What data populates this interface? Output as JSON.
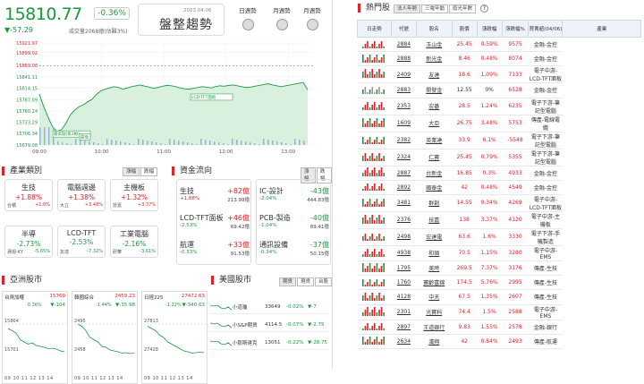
{
  "header": {
    "price": "15810.77",
    "change_pct": "-0.36%",
    "change": "▼-57.29",
    "volume": "成交量2068億(估難3%)",
    "trend_date": "2023.04.06",
    "trend_label": "盤整趨勢",
    "buttons": [
      "日週勢",
      "月週勢",
      "月週勢"
    ]
  },
  "chart_data": {
    "type": "line",
    "x_ticks": [
      "09:00",
      "10:00",
      "11:00",
      "12:00",
      "13:00"
    ],
    "y_ticks": [
      "15921.97",
      "15899.02",
      "15869.08",
      "15841.11",
      "15814.15",
      "15787.09",
      "15760.24",
      "15733.29",
      "15706.34",
      "15679.08"
    ],
    "ylim": [
      15679.08,
      15921.97
    ],
    "reference": 15868.06,
    "annotations": [
      "最高點(第1根)",
      "最低",
      "LCD-TFT面板"
    ],
    "values": [
      15800,
      15770,
      15745,
      15722,
      15712,
      15715,
      15730,
      15750,
      15762,
      15770,
      15775,
      15782,
      15788,
      15800,
      15808,
      15812,
      15815,
      15818,
      15816,
      15812,
      15815,
      15818,
      15820,
      15822,
      15819,
      15817,
      15814,
      15816,
      15819,
      15821,
      15820,
      15818,
      15815,
      15813,
      15812,
      15814,
      15816,
      15818,
      15817,
      15815,
      15818,
      15820,
      15819,
      15821,
      15822,
      15820,
      15818,
      15816,
      15817,
      15819,
      15821,
      15823,
      15825,
      15822,
      15820,
      15818,
      15820,
      15822,
      15824,
      15826,
      15828,
      15810
    ]
  },
  "sections": {
    "industry": "產業類別",
    "flow": "資金流向",
    "asia": "亞洲股市",
    "us": "美國股市"
  },
  "tabs": {
    "industry": [
      "漲幅",
      "跌幅"
    ],
    "flow": [
      "漲幅",
      "跌幅"
    ],
    "us": [
      "期貨",
      "現貨",
      "台股"
    ]
  },
  "industries": [
    {
      "name": "生技",
      "pct": "+1.88%",
      "c": "red",
      "s1": "台積",
      "s2": "+1.0%"
    },
    {
      "name": "電腦週邊",
      "pct": "+1.38%",
      "c": "red",
      "s1": "大立",
      "s2": "+3.48%"
    },
    {
      "name": "主機板",
      "pct": "+1.32%",
      "c": "red",
      "s1": "技嘉",
      "s2": "+3.37%"
    },
    {
      "name": "半導",
      "pct": "-2.73%",
      "c": "grn",
      "s1": "邁視-KY",
      "s2": "-5.65%"
    },
    {
      "name": "LCD-TFT",
      "pct": "-2.53%",
      "c": "grn",
      "s1": "友達",
      "s2": "-7.32%"
    },
    {
      "name": "工業電腦",
      "pct": "-2.16%",
      "c": "grn",
      "s1": "研華",
      "s2": "-3.61%"
    }
  ],
  "flows": [
    {
      "name": "生技",
      "val": "+82億",
      "pct": "+1.88%",
      "sum": "213.99億",
      "c": "red"
    },
    {
      "name": "IC-設計",
      "val": "-43億",
      "pct": "-2.04%",
      "sum": "444.83億",
      "c": "grn"
    },
    {
      "name": "LCD-TFT面板",
      "val": "+46億",
      "pct": "-2.53%",
      "sum": "69.42億",
      "c": "red"
    },
    {
      "name": "PCB-製造",
      "val": "-40億",
      "pct": "-1.04%",
      "sum": "89.41億",
      "c": "grn"
    },
    {
      "name": "航運",
      "val": "+33億",
      "pct": "-0.33%",
      "sum": "91.53億",
      "c": "red"
    },
    {
      "name": "通訊設備",
      "val": "-37億",
      "pct": "-0.34%",
      "sum": "50.15億",
      "c": "grn"
    }
  ],
  "asia": [
    {
      "name": "台灣加權",
      "val": "15760",
      "pct": "-0.36%",
      "chg": "▼-104",
      "y1": "15864",
      "y2": "15701",
      "x": "09 10 11 12 13 14"
    },
    {
      "name": "韓國綜合",
      "val": "2459.23",
      "pct": "-1.44%",
      "chg": "▼-35.98",
      "y1": "2495",
      "y2": "2458",
      "x": "09 10 11 12 13 14"
    },
    {
      "name": "日經225",
      "val": "27472.63",
      "pct": "-1.22%",
      "chg": "▼-340.63",
      "y1": "27813",
      "y2": "27428",
      "x": "09 10 11 12 13 14"
    }
  ],
  "us": [
    {
      "name": "小道瓊",
      "val": "33649",
      "pct": "-0.02%",
      "chg": "▼-7"
    },
    {
      "name": "小S&P期貨",
      "val": "4114.5",
      "pct": "-0.07%",
      "chg": "▼-2.75"
    },
    {
      "name": "小那斯達克",
      "val": "13051",
      "pct": "-0.22%",
      "chg": "▼-28.75"
    }
  ],
  "hot": {
    "title": "熱門股",
    "tabs": [
      "法人年勢",
      "三電年動",
      "廢光年數"
    ],
    "help": "?",
    "headers": [
      "日走勢",
      "代號",
      "股名",
      "股價",
      "漲跌幅",
      "漲跌幅%",
      "買賣超(04/06)",
      "產業"
    ],
    "rows": [
      [
        "2884",
        "玉山金",
        "25.45",
        "0.59%",
        "9575",
        "金融-金控",
        "red"
      ],
      [
        "2888",
        "新光金",
        "8.46",
        "0.48%",
        "8074",
        "金融-金控",
        "red"
      ],
      [
        "2409",
        "友達",
        "18.6",
        "1.09%",
        "7133",
        "電子中游-LCD-TFT面板",
        "red"
      ],
      [
        "2883",
        "開發金",
        "12.55",
        "0%",
        "6528",
        "金融-金控",
        "gray"
      ],
      [
        "2353",
        "宏碁",
        "28.5",
        "1.24%",
        "6235",
        "電子下游-筆記型電腦",
        "red"
      ],
      [
        "1609",
        "大亞",
        "26.75",
        "3.48%",
        "5753",
        "傳產-電線電纜",
        "red"
      ],
      [
        "2382",
        "英業達",
        "33.9",
        "6.1%",
        "-5548",
        "電子下游-筆記型電腦",
        "red"
      ],
      [
        "2324",
        "仁寶",
        "25.45",
        "0.79%",
        "5355",
        "電子下游-筆記型電腦",
        "red"
      ],
      [
        "2887",
        "台新金",
        "16.85",
        "0.3%",
        "4933",
        "金融-金控",
        "red"
      ],
      [
        "2892",
        "國泰金",
        "42",
        "0.48%",
        "4549",
        "金融-金控",
        "red"
      ],
      [
        "3481",
        "群創",
        "14.55",
        "0.34%",
        "4269",
        "電子中游-LCD-TFT面板",
        "red"
      ],
      [
        "2376",
        "技嘉",
        "138",
        "3.37%",
        "4120",
        "電子中游-主機板",
        "red"
      ],
      [
        "2498",
        "宏達電",
        "63.6",
        "1.6%",
        "3330",
        "電子下游-手機製造",
        "red"
      ],
      [
        "4938",
        "和碩",
        "70.5",
        "1.15%",
        "3280",
        "電子中游-EMS",
        "red"
      ],
      [
        "1795",
        "美時",
        "269.5",
        "7.37%",
        "3176",
        "傳產-生技",
        "red"
      ],
      [
        "1760",
        "寶齡富錦",
        "174.5",
        "5.76%",
        "2995",
        "傳產-生技",
        "red"
      ],
      [
        "4128",
        "中天",
        "67.5",
        "1.35%",
        "2607",
        "傳產-生技",
        "red"
      ],
      [
        "2301",
        "光寶科",
        "74.4",
        "1.5%",
        "2588",
        "電子中游-EMS",
        "red"
      ],
      [
        "2897",
        "王道銀行",
        "9.83",
        "1.55%",
        "2578",
        "金融-銀行",
        "red"
      ],
      [
        "2634",
        "漢翔",
        "42",
        "0.84%",
        "2493",
        "傳產-航運",
        "red"
      ]
    ]
  }
}
